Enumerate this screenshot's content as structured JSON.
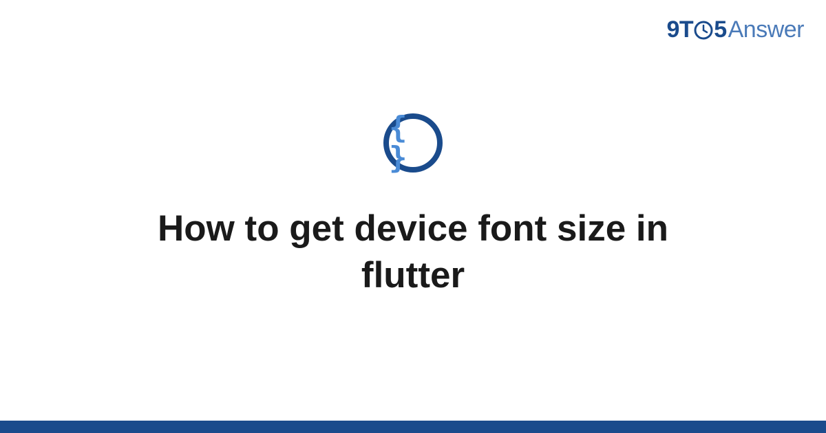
{
  "brand": {
    "nine": "9",
    "t": "T",
    "five": "5",
    "answer": "Answer"
  },
  "icon": {
    "braces": "{ }"
  },
  "title": "How to get device font size in flutter",
  "colors": {
    "primary": "#1a4b8c",
    "accent": "#4a8bd6",
    "logo_light": "#4a7ab8"
  }
}
